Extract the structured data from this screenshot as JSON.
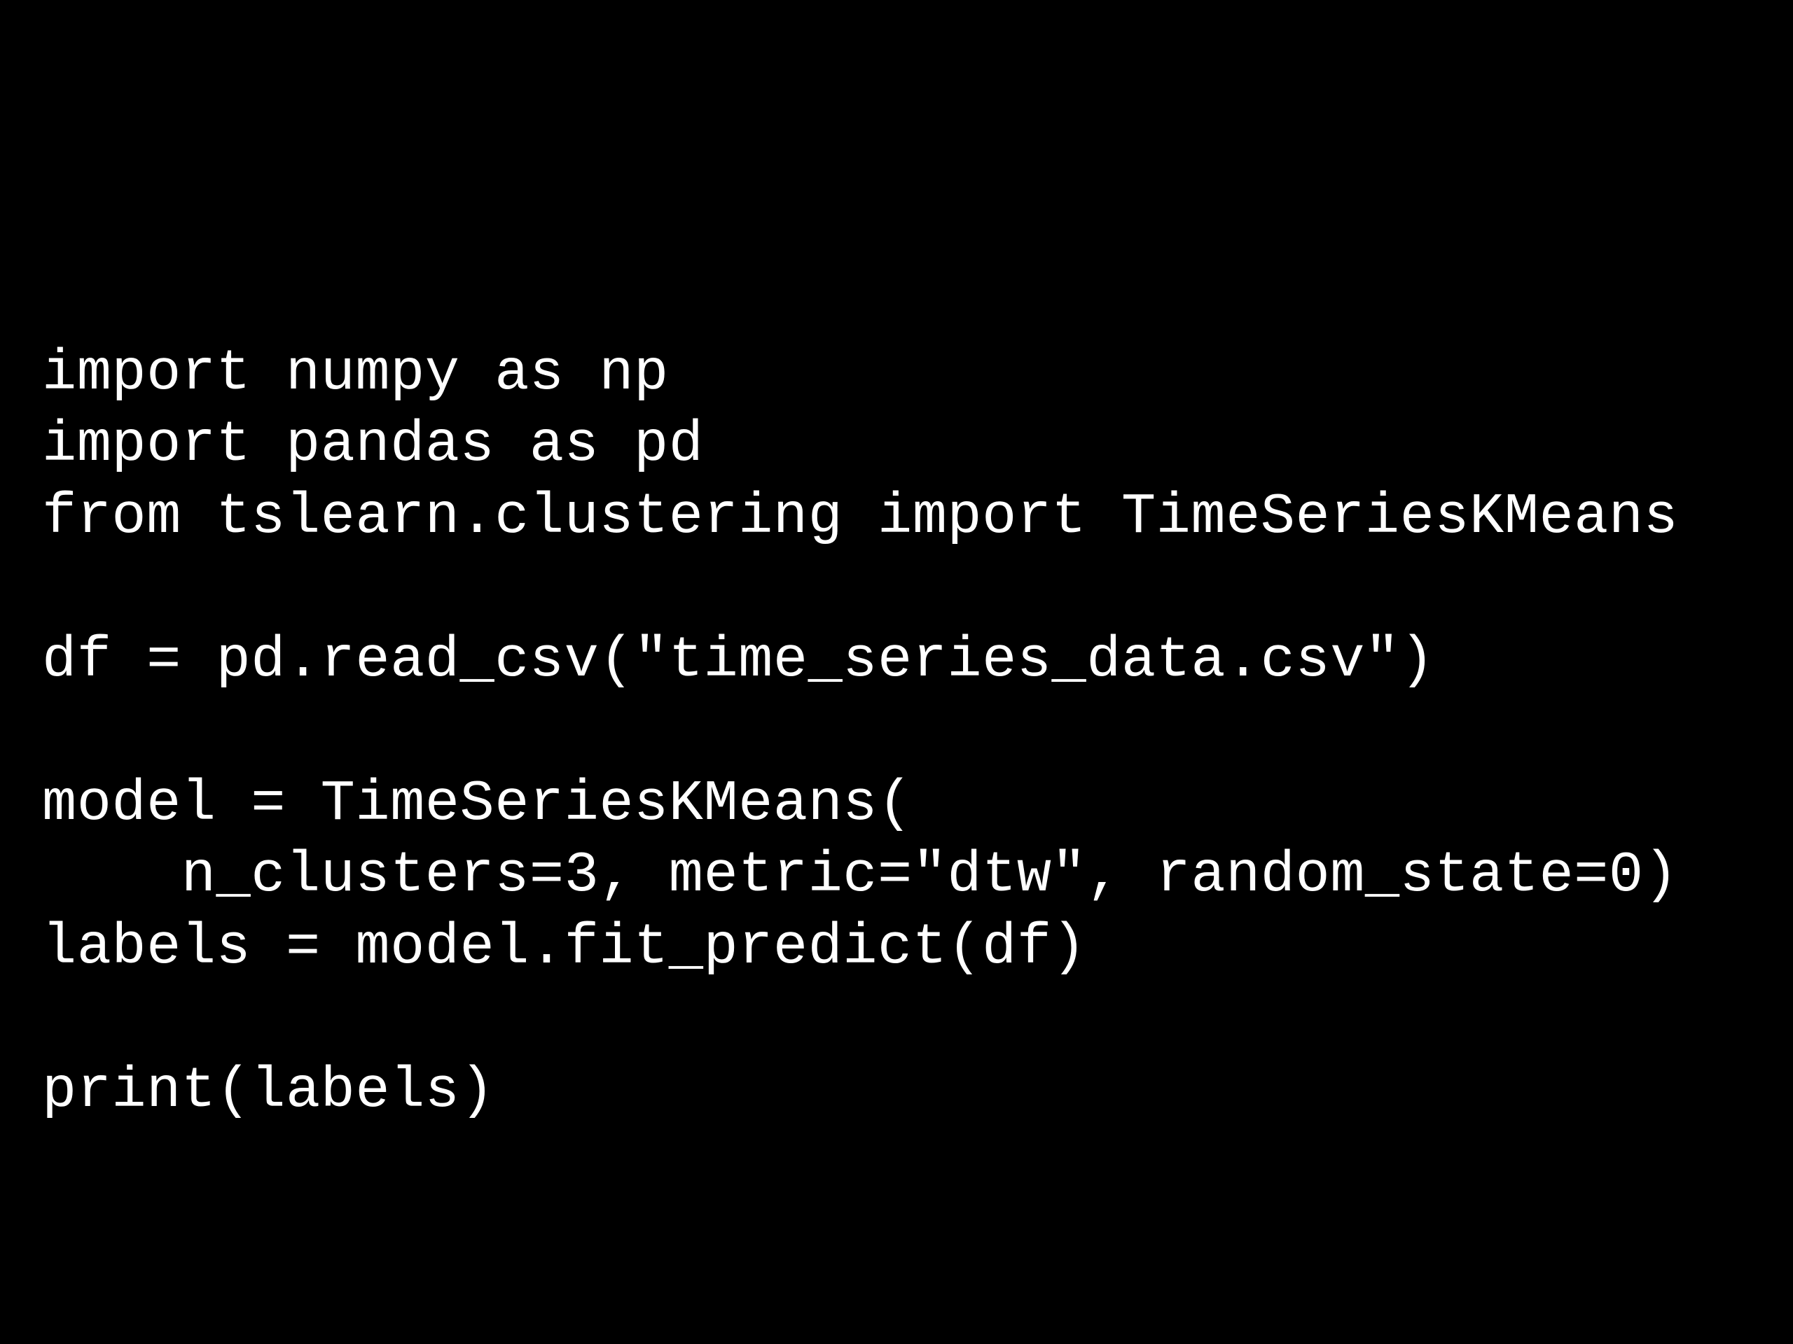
{
  "code": {
    "lines": [
      "import numpy as np",
      "import pandas as pd",
      "from tslearn.clustering import TimeSeriesKMeans",
      "",
      "df = pd.read_csv(\"time_series_data.csv\")",
      "",
      "model = TimeSeriesKMeans(",
      "    n_clusters=3, metric=\"dtw\", random_state=0)",
      "labels = model.fit_predict(df)",
      "",
      "print(labels)"
    ]
  }
}
